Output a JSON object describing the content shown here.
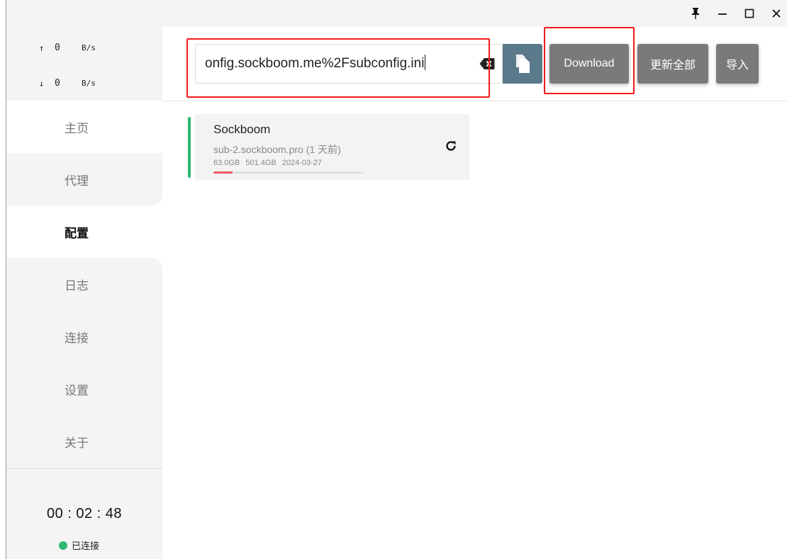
{
  "speeds": {
    "up": {
      "arrow": "↑",
      "value": "0",
      "unit": "B/s"
    },
    "down": {
      "arrow": "↓",
      "value": "0",
      "unit": "B/s"
    }
  },
  "sidebar": {
    "items": [
      {
        "label": "主页"
      },
      {
        "label": "代理"
      },
      {
        "label": "配置"
      },
      {
        "label": "日志"
      },
      {
        "label": "连接"
      },
      {
        "label": "设置"
      },
      {
        "label": "关于"
      }
    ],
    "active_index": 2,
    "timer": "00 : 02 : 48",
    "status": "已连接",
    "status_color": "#2eb872"
  },
  "toolbar": {
    "url_value": "onfig.sockboom.me%2Fsubconfig.ini",
    "download_label": "Download",
    "update_all_label": "更新全部",
    "import_label": "导入"
  },
  "profiles": [
    {
      "name": "Sockboom",
      "source": "sub-2.sockboom.pro (1 天前)",
      "used": "63.0GB",
      "total": "501.4GB",
      "expire": "2024-03-27",
      "usage_fraction": 0.126
    }
  ],
  "colors": {
    "accent_green": "#2eb872",
    "highlight_red": "#ee1c1c",
    "button_gray": "#7a7a7a",
    "paste_blue": "#5a7a8c"
  },
  "icons": {
    "pin": "pin-icon",
    "minimize": "minimize-icon",
    "maximize": "maximize-icon",
    "close": "close-icon",
    "clear": "backspace-clear-icon",
    "paste": "paste-icon",
    "refresh": "refresh-icon"
  }
}
